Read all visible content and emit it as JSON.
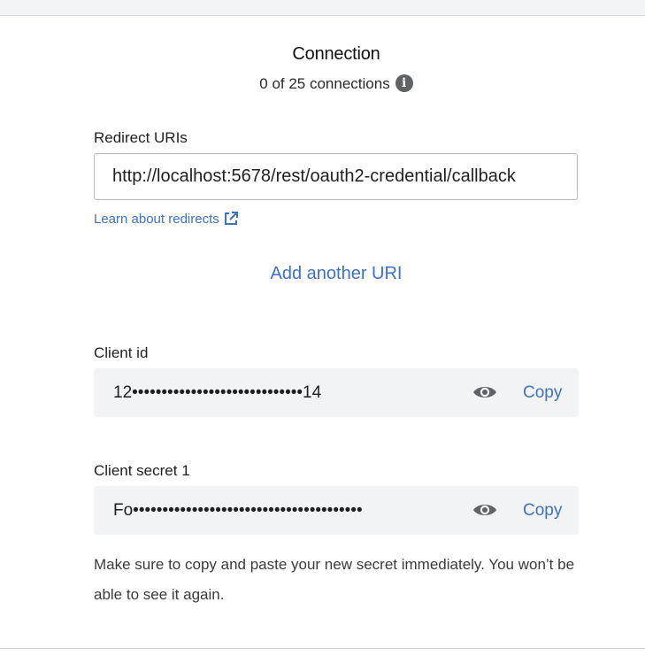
{
  "header": {
    "title": "Connection",
    "connection_count": "0 of 25 connections",
    "info_icon": "info-icon"
  },
  "redirect": {
    "label": "Redirect URIs",
    "uri_value": "http://localhost:5678/rest/oauth2-credential/callback",
    "learn_link": "Learn about redirects",
    "learn_icon": "external-link-icon",
    "add_another": "Add another URI"
  },
  "client_id": {
    "label": "Client id",
    "masked_value": "12•••••••••••••••••••••••••••••14",
    "reveal_icon": "eye-icon",
    "copy_label": "Copy"
  },
  "client_secret": {
    "label": "Client secret 1",
    "masked_value": "Fo•••••••••••••••••••••••••••••••••••••••",
    "reveal_icon": "eye-icon",
    "copy_label": "Copy"
  },
  "notice": {
    "text": "Make sure to copy and paste your new secret immediately. You won’t be able to see it again."
  },
  "colors": {
    "link": "#3d72c2",
    "field_bg": "#f2f3f4",
    "border": "#b7bbc0",
    "icon": "#5f6368"
  }
}
